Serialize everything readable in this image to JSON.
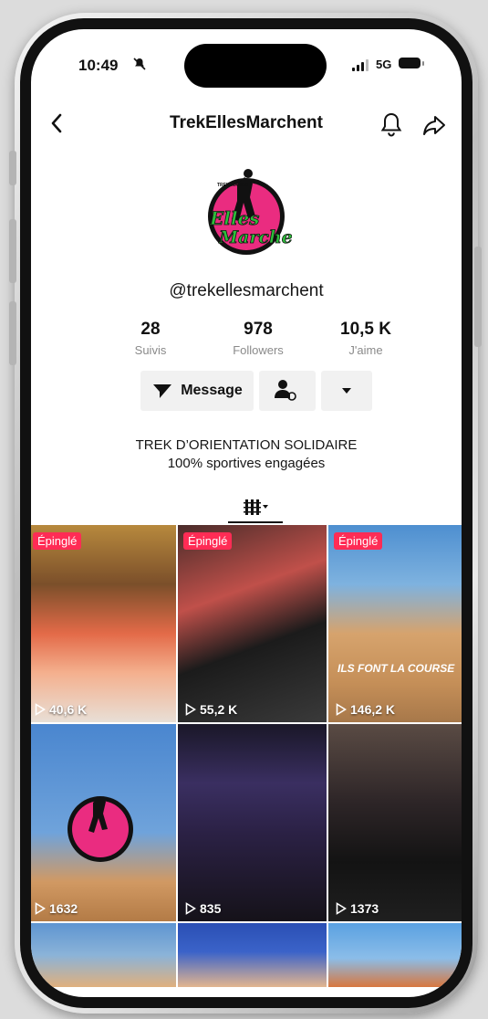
{
  "status_bar": {
    "time": "10:49",
    "network": "5G"
  },
  "header": {
    "title": "TrekEllesMarchent"
  },
  "profile": {
    "handle": "@trekellesmarchent",
    "logo_text_top": "TREK MAROC",
    "logo_text_main1": "Elles",
    "logo_text_main2": "Marchent",
    "stats": [
      {
        "value": "28",
        "label": "Suivis"
      },
      {
        "value": "978",
        "label": "Followers"
      },
      {
        "value": "10,5 K",
        "label": "J'aime"
      }
    ],
    "message_label": "Message",
    "bio_line1": "TREK D’ORIENTATION SOLIDAIRE",
    "bio_line2": "100% sportives engagées"
  },
  "videos": [
    {
      "views": "40,6 K",
      "pinned": "Épinglé"
    },
    {
      "views": "55,2 K",
      "pinned": "Épinglé"
    },
    {
      "views": "146,2 K",
      "pinned": "Épinglé",
      "overlay": "ILS FONT LA COURSE"
    },
    {
      "views": "1632"
    },
    {
      "views": "835"
    },
    {
      "views": "1373"
    }
  ],
  "colors": {
    "pin_badge": "#ff2c55",
    "brand_pink": "#e9207a"
  }
}
